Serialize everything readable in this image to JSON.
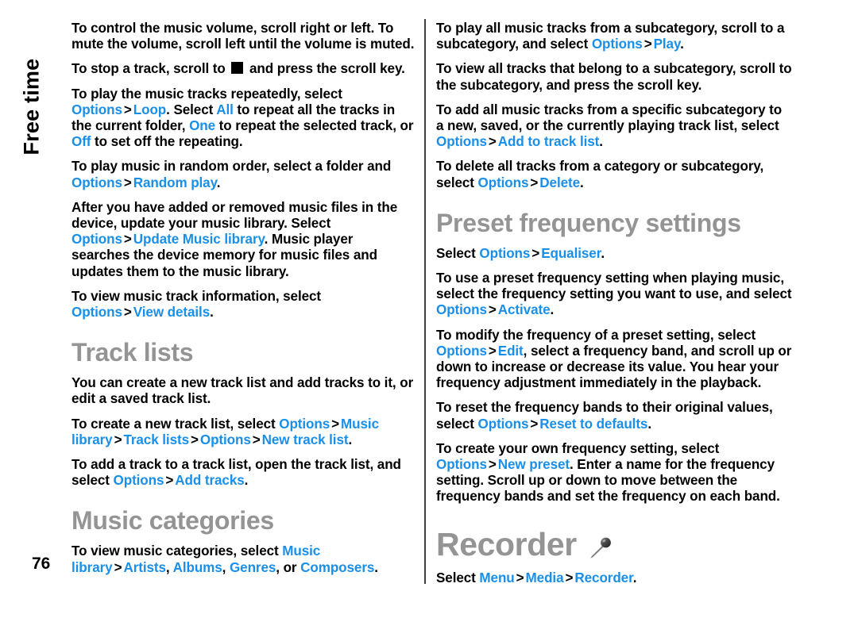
{
  "document": {
    "page_number": "76",
    "chapter_tab": "Free time",
    "accent_color": "#1a8fe8",
    "heading_color": "#949494"
  },
  "left_column": {
    "p1_a": "To control the music volume, scroll right or left. To mute the volume, scroll left until the volume is muted.",
    "p2_a": "To stop a track, scroll to ",
    "p2_b": " and press the scroll key.",
    "p3_a": "To play the music tracks repeatedly, select ",
    "p3_ui1": "Options",
    "p3_sep1": ">",
    "p3_ui2": "Loop",
    "p3_b": ". Select ",
    "p3_ui3": "All",
    "p3_c": " to repeat all the tracks in the current folder, ",
    "p3_ui4": "One",
    "p3_d": " to repeat the selected track, or ",
    "p3_ui5": "Off",
    "p3_e": " to set off the repeating.",
    "p4_a": "To play music in random order, select a folder and ",
    "p4_ui1": "Options",
    "p4_sep1": ">",
    "p4_ui2": "Random play",
    "p4_b": ".",
    "p5_a": "After you have added or removed music files in the device, update your music library. Select ",
    "p5_ui1": "Options",
    "p5_sep1": ">",
    "p5_ui2": "Update Music library",
    "p5_b": ". Music player searches the device memory for music files and updates them to the music library.",
    "p6_a": "To view music track information, select ",
    "p6_ui1": "Options",
    "p6_sep1": ">",
    "p6_ui2": "View details",
    "p6_b": ".",
    "heading_track_lists": "Track lists",
    "p7_a": "You can create a new track list and add tracks to it, or edit a saved track list.",
    "p8_a": "To create a new track list, select ",
    "p8_ui1": "Options",
    "p8_sep1": ">",
    "p8_ui2": "Music library",
    "p8_sep2": ">",
    "p8_ui3": "Track lists",
    "p8_sep3": ">",
    "p8_ui4": "Options",
    "p8_sep4": ">",
    "p8_ui5": "New track list",
    "p8_b": ".",
    "p9_a": "To add a track to a track list, open the track list, and select ",
    "p9_ui1": "Options",
    "p9_sep1": ">",
    "p9_ui2": "Add tracks",
    "p9_b": ".",
    "heading_music_categories": "Music categories",
    "p10_a": "To view music categories, select ",
    "p10_ui1": "Music library",
    "p10_sep1": ">",
    "p10_ui2": "Artists",
    "p10_b": ", ",
    "p10_ui3": "Albums",
    "p10_c": ", ",
    "p10_ui4": "Genres",
    "p10_d": ", or ",
    "p10_ui5": "Composers",
    "p10_e": "."
  },
  "right_column": {
    "p1_a": "To play all music tracks from a subcategory, scroll to a subcategory, and select ",
    "p1_ui1": "Options",
    "p1_sep1": ">",
    "p1_ui2": "Play",
    "p1_b": ".",
    "p2_a": "To view all tracks that belong to a subcategory, scroll to the subcategory, and press the scroll key.",
    "p3_a": "To add all music tracks from a specific subcategory to a new, saved, or the currently playing track list, select ",
    "p3_ui1": "Options",
    "p3_sep1": ">",
    "p3_ui2": "Add to track list",
    "p3_b": ".",
    "p4_a": "To delete all tracks from a category or subcategory, select ",
    "p4_ui1": "Options",
    "p4_sep1": ">",
    "p4_ui2": "Delete",
    "p4_b": ".",
    "heading_preset": "Preset frequency settings",
    "p5_a": "Select ",
    "p5_ui1": "Options",
    "p5_sep1": ">",
    "p5_ui2": "Equaliser",
    "p5_b": ".",
    "p6_a": "To use a preset frequency setting when playing music, select the frequency setting you want to use, and select ",
    "p6_ui1": "Options",
    "p6_sep1": ">",
    "p6_ui2": "Activate",
    "p6_b": ".",
    "p7_a": "To modify the frequency of a preset setting, select ",
    "p7_ui1": "Options",
    "p7_sep1": ">",
    "p7_ui2": "Edit",
    "p7_b": ", select a frequency band, and scroll up or down to increase or decrease its value. You hear your frequency adjustment immediately in the playback.",
    "p8_a": "To reset the frequency bands to their original values, select ",
    "p8_ui1": "Options",
    "p8_sep1": ">",
    "p8_ui2": "Reset to defaults",
    "p8_b": ".",
    "p9_a": "To create your own frequency setting, select ",
    "p9_ui1": "Options",
    "p9_sep1": ">",
    "p9_ui2": "New preset",
    "p9_b": ". Enter a name for the frequency setting. Scroll up or down to move between the frequency bands and set the frequency on each band.",
    "heading_recorder": "Recorder",
    "recorder_icon": "microphone-icon",
    "p10_a": "Select ",
    "p10_ui1": "Menu",
    "p10_sep1": ">",
    "p10_ui2": "Media",
    "p10_sep2": ">",
    "p10_ui3": "Recorder",
    "p10_b": "."
  }
}
